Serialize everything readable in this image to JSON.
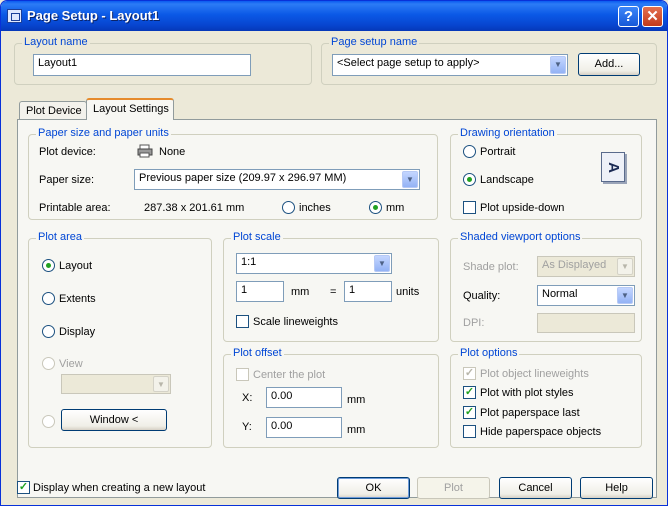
{
  "window": {
    "title": "Page Setup - Layout1",
    "help": "?",
    "close": "✕"
  },
  "layout_name": {
    "legend": "Layout name",
    "value": "Layout1"
  },
  "page_setup_name": {
    "legend": "Page setup name",
    "value": "<Select page setup to apply>",
    "add_label": "Add..."
  },
  "tabs": [
    {
      "label": "Plot Device",
      "active": false
    },
    {
      "label": "Layout Settings",
      "active": true
    }
  ],
  "paper": {
    "legend": "Paper size and paper units",
    "plot_device_label": "Plot device:",
    "plot_device_value": "None",
    "paper_size_label": "Paper size:",
    "paper_size_value": "Previous paper size (209.97 x 296.97 MM)",
    "printable_label": "Printable area:",
    "printable_value": "287.38 x 201.61 mm",
    "units": {
      "inches": "inches",
      "mm": "mm",
      "selected": "mm"
    }
  },
  "orientation": {
    "legend": "Drawing orientation",
    "portrait": "Portrait",
    "landscape": "Landscape",
    "selected": "Landscape",
    "upside_down": "Plot upside-down",
    "upside_down_checked": false,
    "preview_letter": "A"
  },
  "plot_area": {
    "legend": "Plot area",
    "layout": "Layout",
    "extents": "Extents",
    "display": "Display",
    "view": "View",
    "window_label": "Window <",
    "selected": "Layout"
  },
  "plot_scale": {
    "legend": "Plot scale",
    "scale_value": "1:1",
    "mm_value": "1",
    "mm_label": "mm",
    "equals": "=",
    "units_value": "1",
    "units_label": "units",
    "scale_lineweights": "Scale lineweights",
    "scale_lineweights_checked": false
  },
  "plot_offset": {
    "legend": "Plot offset",
    "center": "Center the plot",
    "x_label": "X:",
    "x_value": "0.00",
    "x_unit": "mm",
    "y_label": "Y:",
    "y_value": "0.00",
    "y_unit": "mm"
  },
  "shaded": {
    "legend": "Shaded viewport options",
    "shade_plot_label": "Shade plot:",
    "shade_plot_value": "As Displayed",
    "quality_label": "Quality:",
    "quality_value": "Normal",
    "dpi_label": "DPI:",
    "dpi_value": ""
  },
  "plot_options": {
    "legend": "Plot options",
    "items": [
      {
        "label": "Plot object lineweights",
        "checked": true,
        "disabled": true
      },
      {
        "label": "Plot with plot styles",
        "checked": true,
        "disabled": false
      },
      {
        "label": "Plot paperspace last",
        "checked": true,
        "disabled": false
      },
      {
        "label": "Hide paperspace objects",
        "checked": false,
        "disabled": false
      }
    ]
  },
  "footer": {
    "display_new_layout": "Display when creating a new layout",
    "display_new_layout_checked": true,
    "ok": "OK",
    "plot": "Plot",
    "cancel": "Cancel",
    "help": "Help"
  },
  "colors": {
    "accent": "#0046d5",
    "title_bar": "#0b59e6",
    "check_green": "#21a121"
  }
}
